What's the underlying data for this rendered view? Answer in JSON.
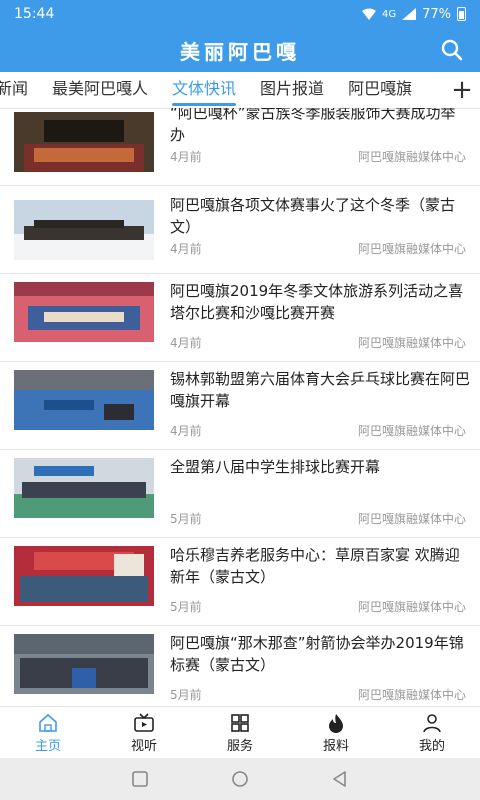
{
  "status": {
    "time": "15:44",
    "network": "4G",
    "battery": "77%"
  },
  "app": {
    "title": "美丽阿巴嘎"
  },
  "tabs": [
    {
      "label": "新闻"
    },
    {
      "label": "最美阿巴嘎人"
    },
    {
      "label": "文体快讯",
      "active": true
    },
    {
      "label": "图片报道"
    },
    {
      "label": "阿巴嘎旗"
    }
  ],
  "feed": [
    {
      "title": "“阿巴嘎杯”蒙古族冬季服装服饰大赛成功举办",
      "time": "4月前",
      "source": "阿巴嘎旗融媒体中心"
    },
    {
      "title": "阿巴嘎旗各项文体赛事火了这个冬季（蒙古文）",
      "time": "4月前",
      "source": "阿巴嘎旗融媒体中心"
    },
    {
      "title": "阿巴嘎旗2019年冬季文体旅游系列活动之喜塔尔比赛和沙嘎比赛开赛",
      "time": "4月前",
      "source": "阿巴嘎旗融媒体中心"
    },
    {
      "title": "锡林郭勒盟第六届体育大会乒乓球比赛在阿巴嘎旗开幕",
      "time": "4月前",
      "source": "阿巴嘎旗融媒体中心"
    },
    {
      "title": "全盟第八届中学生排球比赛开幕",
      "time": "5月前",
      "source": "阿巴嘎旗融媒体中心"
    },
    {
      "title": "哈乐穆吉养老服务中心：草原百家宴 欢腾迎新年（蒙古文）",
      "time": "5月前",
      "source": "阿巴嘎旗融媒体中心"
    },
    {
      "title": "阿巴嘎旗“那木那查”射箭协会举办2019年锦标赛（蒙古文）",
      "time": "5月前",
      "source": "阿巴嘎旗融媒体中心"
    }
  ],
  "nav": [
    {
      "label": "主页",
      "icon": "home-icon"
    },
    {
      "label": "视听",
      "icon": "tv-icon"
    },
    {
      "label": "服务",
      "icon": "grid-icon"
    },
    {
      "label": "报料",
      "icon": "fire-icon"
    },
    {
      "label": "我的",
      "icon": "user-icon"
    }
  ],
  "colors": {
    "accent": "#3d9bea"
  }
}
